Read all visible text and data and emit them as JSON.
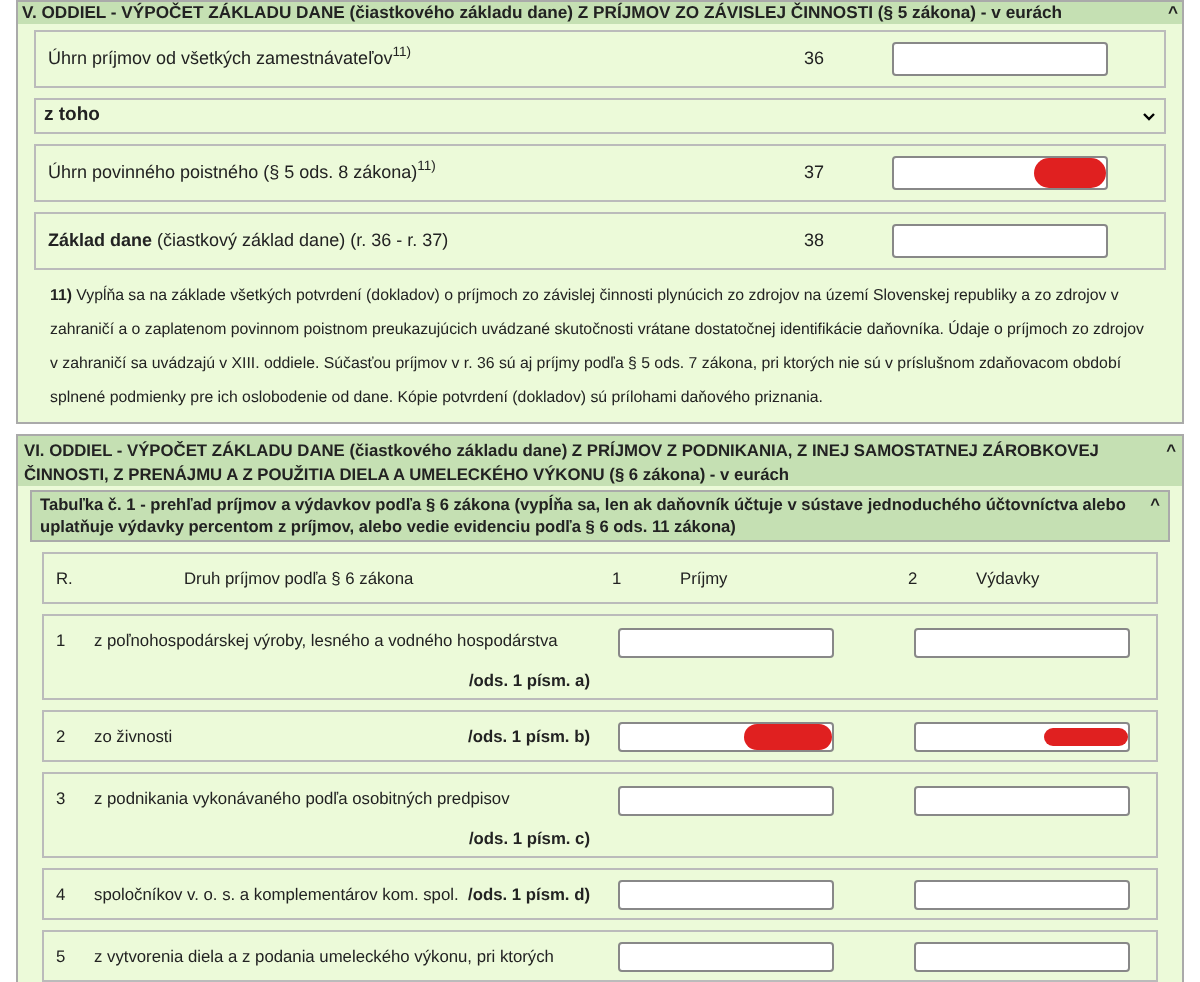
{
  "section_v": {
    "title": "V. ODDIEL - VÝPOČET ZÁKLADU DANE (čiastkového základu dane) Z PRÍJMOV ZO ZÁVISLEJ ČINNOSTI (§ 5 zákona) - v eurách",
    "collapse_icon": "^",
    "rows_before": [
      {
        "label": "Úhrn príjmov od všetkých zamestnávateľov$^{11)}$",
        "number": "36",
        "redacted": false
      }
    ],
    "subgroup": {
      "label": "z toho",
      "expanded": true
    },
    "rows_after": [
      {
        "label": "Úhrn povinného poistného (§ 5 ods. 8 zákona)$^{11)}$",
        "number": "37",
        "redacted": true
      },
      {
        "label": "**Základ dane** (čiastkový základ dane) (r. 36 - r. 37)",
        "number": "38",
        "redacted": false
      }
    ],
    "footnote": "**11)** Vypĺňa sa na základe všetkých potvrdení (dokladov) o príjmoch zo závislej činnosti plynúcich zo zdrojov na území Slovenskej republiky a zo zdrojov v zahraničí a o zaplatenom povinnom poistnom preukazujúcich uvádzané skutočnosti vrátane dostatočnej identifikácie daňovníka. Údaje o príjmoch zo zdrojov v zahraničí sa uvádzajú v XIII. oddiele. Súčasťou príjmov v r. 36 sú aj príjmy podľa § 5 ods. 7 zákona, pri ktorých nie sú v príslušnom zdaňovacom období splnené podmienky pre ich oslobodenie od dane. Kópie potvrdení (dokladov) sú prílohami daňového priznania."
  },
  "section_vi": {
    "title": "VI. ODDIEL - VÝPOČET ZÁKLADU DANE (čiastkového základu dane) Z PRÍJMOV Z PODNIKANIA, Z INEJ SAMOSTATNEJ ZÁROBKOVEJ ČINNOSTI, Z PRENÁJMU A Z POUŽITIA DIELA A UMELECKÉHO VÝKONU (§ 6 zákona) - v eurách",
    "collapse_icon": "^",
    "table": {
      "title": "Tabuľka č. 1 - prehľad príjmov a výdavkov podľa § 6 zákona (vypĺňa sa, len ak daňovník účtuje v sústave jednoduchého účtovníctva alebo uplatňuje výdavky percentom z príjmov, alebo vedie evidenciu podľa § 6 ods. 11 zákona)",
      "collapse_icon": "^",
      "columns": {
        "r": "R.",
        "type": "Druh príjmov podľa § 6 zákona",
        "col1_number": "1",
        "col1": "Príjmy",
        "col2_number": "2",
        "col2": "Výdavky"
      },
      "rows": [
        {
          "r": "1",
          "label": "z poľnohospodárskej výroby, lesného a vodného hospodárstva",
          "ref": "/ods. 1 písm. a)",
          "wrap": true,
          "redacted_1": false,
          "redacted_2": false
        },
        {
          "r": "2",
          "label": "zo živnosti",
          "ref": "/ods. 1 písm. b)",
          "wrap": false,
          "redacted_1": true,
          "redacted_2": true
        },
        {
          "r": "3",
          "label": "z podnikania vykonávaného podľa osobitných predpisov",
          "ref": "/ods. 1 písm. c)",
          "wrap": true,
          "redacted_1": false,
          "redacted_2": false
        },
        {
          "r": "4",
          "label": "spoločníkov v. o. s. a komplementárov kom. spol.",
          "ref": "/ods. 1 písm. d)",
          "wrap": false,
          "redacted_1": false,
          "redacted_2": false
        },
        {
          "r": "5",
          "label": "z vytvorenia diela a z podania umeleckého výkonu, pri ktorých",
          "wrap": false,
          "redacted_1": false,
          "redacted_2": false
        }
      ]
    }
  }
}
